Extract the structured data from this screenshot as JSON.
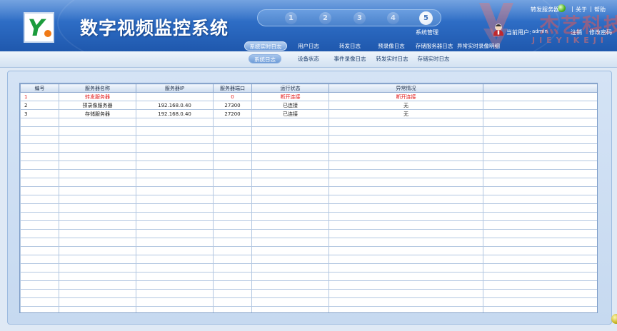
{
  "app": {
    "title": "数字视频监控系统"
  },
  "steps": {
    "items": [
      "1",
      "2",
      "3",
      "4",
      "5"
    ],
    "active_label": "系统管理"
  },
  "header_right": {
    "forward_server_label": "转发服务器",
    "about": "关于",
    "help": "帮助",
    "separator": "|",
    "current_user_label": "当前用户:",
    "current_user_name": "admin",
    "logout": "注销",
    "change_password": "修改密码",
    "watermark": "杰艺科技",
    "watermark_sub": "JIEYIKEJI"
  },
  "nav1": [
    "系统实时日志",
    "用户日志",
    "转发日志",
    "预录像日志",
    "存储服务器日志",
    "异常实时录像明细"
  ],
  "nav2": [
    "系统日志",
    "设备状态",
    "事件录像日志",
    "转发实时日志",
    "存储实时日志"
  ],
  "table": {
    "columns": [
      "编号",
      "服务器名称",
      "服务器IP",
      "服务器端口",
      "运行状态",
      "异常情况",
      ""
    ],
    "rows": [
      {
        "id": "1",
        "name": "转发服务器",
        "ip": "",
        "port": "0",
        "status": "断开连接",
        "abnormal": "断开连接",
        "alarm": true
      },
      {
        "id": "2",
        "name": "预录像服务器",
        "ip": "192.168.0.40",
        "port": "27300",
        "status": "已连接",
        "abnormal": "无",
        "alarm": false
      },
      {
        "id": "3",
        "name": "存储服务器",
        "ip": "192.168.0.40",
        "port": "27200",
        "status": "已连接",
        "abnormal": "无",
        "alarm": false
      }
    ]
  },
  "colors": {
    "header_blue": "#2d6cc4",
    "alarm_red": "#e21a1a",
    "status_green": "#4fb320"
  }
}
